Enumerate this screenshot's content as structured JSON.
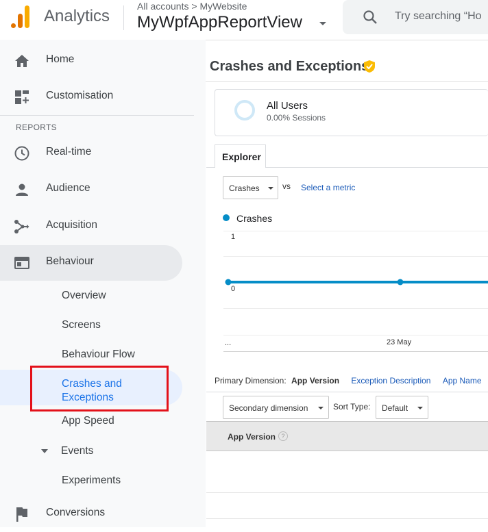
{
  "header": {
    "brand": "Analytics",
    "breadcrumb": "All accounts > MyWebsite",
    "view_name": "MyWpfAppReportView",
    "search_placeholder": "Try searching “Ho"
  },
  "sidebar": {
    "top_items": [
      {
        "label": "Home",
        "icon": "home-icon"
      },
      {
        "label": "Customisation",
        "icon": "customisation-icon"
      }
    ],
    "section_label": "REPORTS",
    "report_items": [
      {
        "label": "Real-time",
        "icon": "clock-icon"
      },
      {
        "label": "Audience",
        "icon": "person-icon"
      },
      {
        "label": "Acquisition",
        "icon": "acquisition-icon"
      },
      {
        "label": "Behaviour",
        "icon": "behaviour-icon"
      }
    ],
    "behaviour_sub": [
      {
        "label": "Overview"
      },
      {
        "label": "Screens"
      },
      {
        "label": "Behaviour Flow"
      },
      {
        "label": "Crashes and\nExceptions"
      },
      {
        "label": "App Speed"
      },
      {
        "label": "Events"
      },
      {
        "label": "Experiments"
      }
    ],
    "bottom_items": [
      {
        "label": "Conversions",
        "icon": "flag-icon"
      }
    ]
  },
  "main": {
    "title": "Crashes and Exceptions",
    "segment": {
      "title": "All Users",
      "subtitle": "0.00% Sessions"
    },
    "tab": "Explorer",
    "metric_select": "Crashes",
    "vs": "vs",
    "select_metric": "Select a metric",
    "primary_dimension_label": "Primary Dimension:",
    "primary_dimensions": [
      "App Version",
      "Exception Description",
      "App Name"
    ],
    "secondary_dimension": "Secondary dimension",
    "sort_type_label": "Sort Type:",
    "sort_type_value": "Default",
    "table_header": "App Version",
    "help": "?"
  },
  "colors": {
    "accent": "#1a73e8",
    "series": "#058dc7",
    "highlight_box": "#e3111a",
    "verified": "#fbbc04"
  },
  "chart_data": {
    "type": "line",
    "series": [
      {
        "name": "Crashes",
        "values": [
          0,
          0,
          0
        ]
      }
    ],
    "x_labels": [
      "...",
      "23 May",
      ""
    ],
    "y_ticks": [
      1,
      0
    ],
    "ylim": [
      0,
      1
    ]
  }
}
